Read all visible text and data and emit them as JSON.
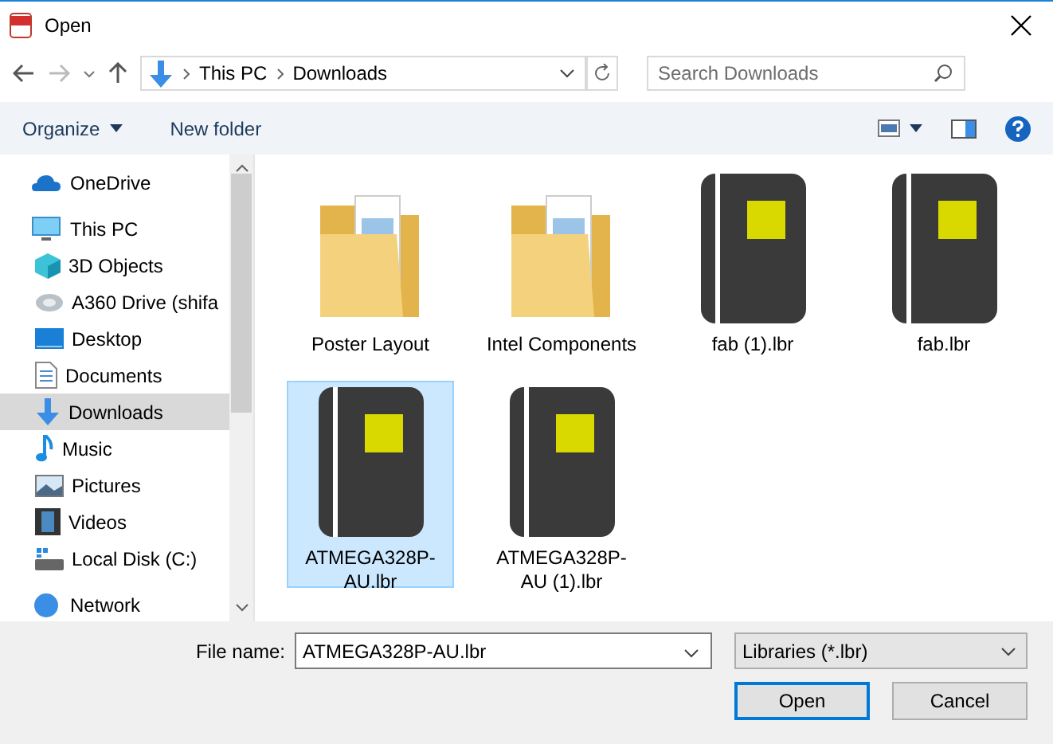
{
  "window": {
    "title": "Open"
  },
  "address": {
    "path": [
      "This PC",
      "Downloads"
    ],
    "search_placeholder": "Search Downloads"
  },
  "toolbar": {
    "organize": "Organize",
    "new_folder": "New folder"
  },
  "sidebar": {
    "items": [
      {
        "label": "OneDrive",
        "kind": "cloud",
        "selected": false
      },
      {
        "label": "This PC",
        "kind": "pc",
        "selected": false,
        "children": [
          {
            "label": "3D Objects",
            "kind": "cube",
            "selected": false
          },
          {
            "label": "A360 Drive (shifa",
            "kind": "drive",
            "selected": false
          },
          {
            "label": "Desktop",
            "kind": "desktop",
            "selected": false
          },
          {
            "label": "Documents",
            "kind": "document",
            "selected": false
          },
          {
            "label": "Downloads",
            "kind": "download",
            "selected": true
          },
          {
            "label": "Music",
            "kind": "music",
            "selected": false
          },
          {
            "label": "Pictures",
            "kind": "pictures",
            "selected": false
          },
          {
            "label": "Videos",
            "kind": "videos",
            "selected": false
          },
          {
            "label": "Local Disk (C:)",
            "kind": "disk",
            "selected": false
          }
        ]
      },
      {
        "label": "Network",
        "kind": "network",
        "selected": false
      }
    ]
  },
  "files": [
    {
      "name": "Poster Layout",
      "kind": "folder",
      "selected": false
    },
    {
      "name": "Intel Components",
      "kind": "folder",
      "selected": false
    },
    {
      "name": "fab (1).lbr",
      "kind": "library",
      "selected": false
    },
    {
      "name": "fab.lbr",
      "kind": "library",
      "selected": false
    },
    {
      "name": "ATMEGA328P-AU.lbr",
      "kind": "library",
      "selected": true
    },
    {
      "name": "ATMEGA328P-AU (1).lbr",
      "kind": "library",
      "selected": false
    }
  ],
  "footer": {
    "file_name_label": "File name:",
    "file_name": "ATMEGA328P-AU.lbr",
    "file_type": "Libraries (*.lbr)",
    "open": "Open",
    "cancel": "Cancel"
  }
}
